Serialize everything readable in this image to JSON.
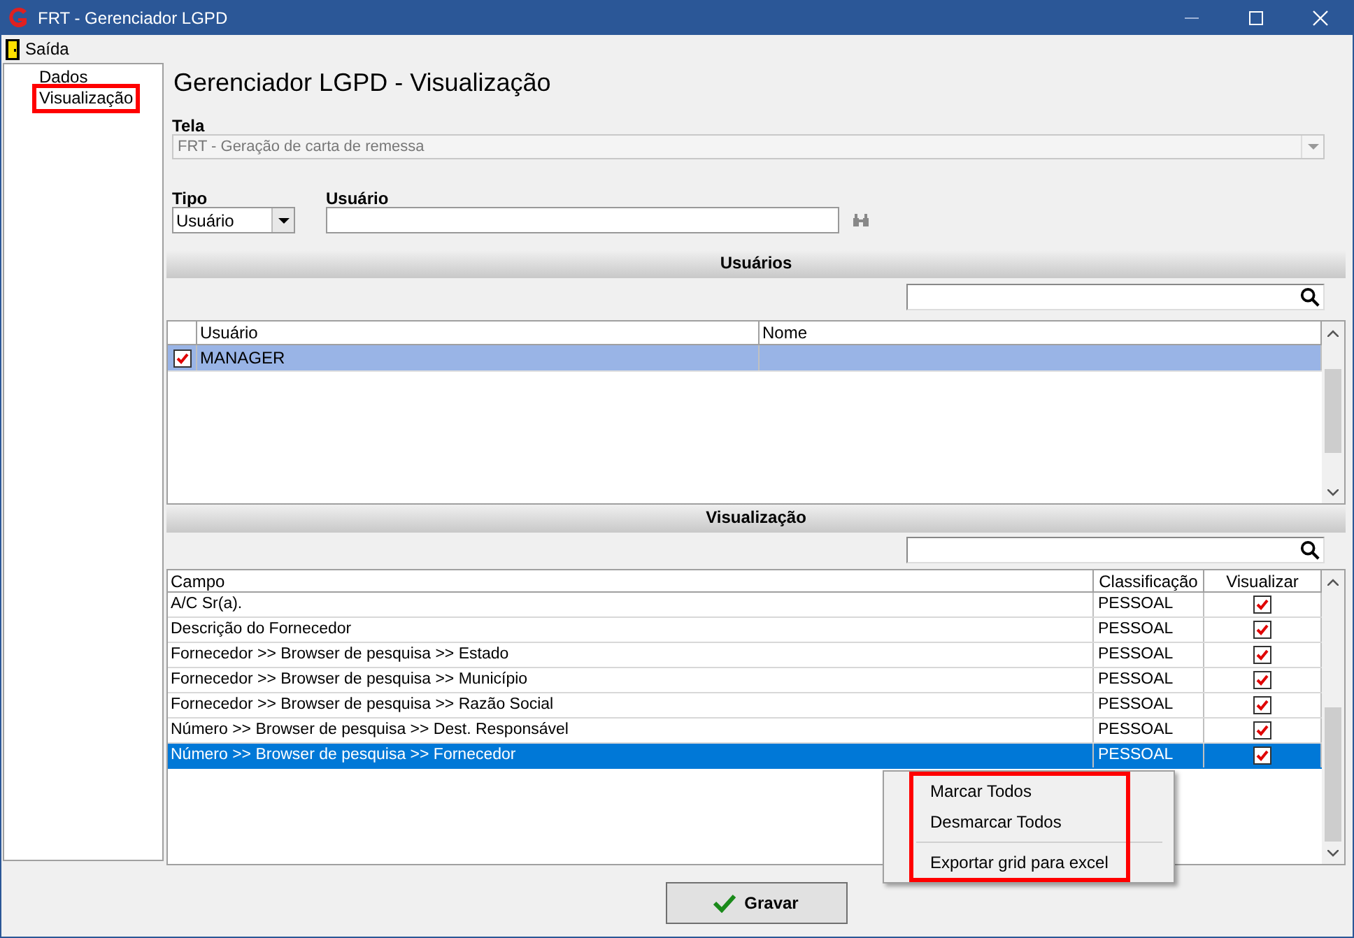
{
  "window": {
    "title": "FRT - Gerenciador LGPD"
  },
  "menu": [
    {
      "label": "Saída"
    }
  ],
  "sidebar": {
    "items": [
      {
        "label": "Dados",
        "highlighted": false
      },
      {
        "label": "Visualização",
        "highlighted": true
      }
    ]
  },
  "heading": "Gerenciador LGPD - Visualização",
  "tela": {
    "label": "Tela",
    "value": "FRT - Geração de carta de remessa",
    "disabled": true
  },
  "tipo": {
    "label": "Tipo",
    "value": "Usuário"
  },
  "usuario": {
    "label": "Usuário"
  },
  "users_section": {
    "title": "Usuários",
    "columns": [
      "Usuário",
      "Nome"
    ],
    "rows": [
      {
        "checked": true,
        "selected": true,
        "cells": [
          "MANAGER",
          ""
        ]
      }
    ]
  },
  "view_section": {
    "title": "Visualização",
    "columns": [
      "Campo",
      "Classificação",
      "Visualizar"
    ],
    "rows": [
      {
        "campo": "A/C Sr(a).",
        "classificacao": "PESSOAL",
        "visualizar": true,
        "selected": false
      },
      {
        "campo": "Descrição do Fornecedor",
        "classificacao": "PESSOAL",
        "visualizar": true,
        "selected": false
      },
      {
        "campo": "Fornecedor >> Browser de pesquisa >> Estado",
        "classificacao": "PESSOAL",
        "visualizar": true,
        "selected": false
      },
      {
        "campo": "Fornecedor >> Browser de pesquisa >> Município",
        "classificacao": "PESSOAL",
        "visualizar": true,
        "selected": false
      },
      {
        "campo": "Fornecedor >> Browser de pesquisa >> Razão Social",
        "classificacao": "PESSOAL",
        "visualizar": true,
        "selected": false
      },
      {
        "campo": "Número >> Browser de pesquisa >> Dest. Responsável",
        "classificacao": "PESSOAL",
        "visualizar": true,
        "selected": false
      },
      {
        "campo": "Número >> Browser de pesquisa >> Fornecedor",
        "classificacao": "PESSOAL",
        "visualizar": true,
        "selected": true
      }
    ]
  },
  "context_menu": {
    "highlighted": true,
    "items": [
      {
        "label": "Marcar Todos",
        "kind": "item"
      },
      {
        "label": "Desmarcar Todos",
        "kind": "item"
      },
      {
        "kind": "separator"
      },
      {
        "label": "Exportar grid para excel",
        "kind": "item"
      }
    ]
  },
  "save_button": {
    "label": "Gravar"
  }
}
